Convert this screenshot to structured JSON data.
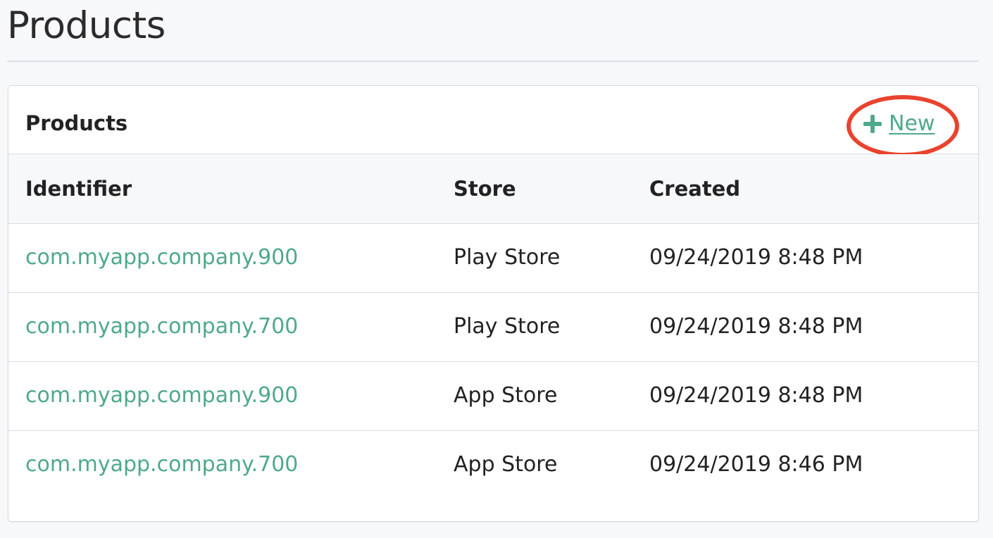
{
  "page": {
    "title": "Products"
  },
  "card": {
    "title": "Products",
    "new_label": "New"
  },
  "table": {
    "columns": [
      "Identifier",
      "Store",
      "Created"
    ],
    "rows": [
      {
        "identifier": "com.myapp.company.900",
        "store": "Play Store",
        "created": "09/24/2019 8:48 PM"
      },
      {
        "identifier": "com.myapp.company.700",
        "store": "Play Store",
        "created": "09/24/2019 8:48 PM"
      },
      {
        "identifier": "com.myapp.company.900",
        "store": "App Store",
        "created": "09/24/2019 8:48 PM"
      },
      {
        "identifier": "com.myapp.company.700",
        "store": "App Store",
        "created": "09/24/2019 8:46 PM"
      }
    ]
  },
  "colors": {
    "accent": "#4ea98b",
    "highlight": "#e8432e"
  },
  "icons": {
    "new": "plus-icon"
  }
}
